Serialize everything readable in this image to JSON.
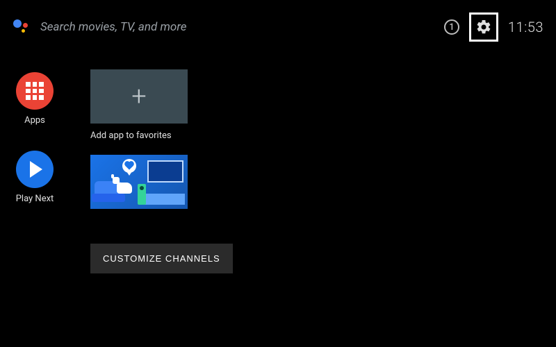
{
  "topbar": {
    "search_placeholder": "Search movies, TV, and more",
    "info_char": "①",
    "clock": "11:53"
  },
  "sidebar": {
    "apps_label": "Apps",
    "playnext_label": "Play Next"
  },
  "main": {
    "add_favorite_label": "Add app to favorites",
    "customize_label": "CUSTOMIZE CHANNELS"
  }
}
